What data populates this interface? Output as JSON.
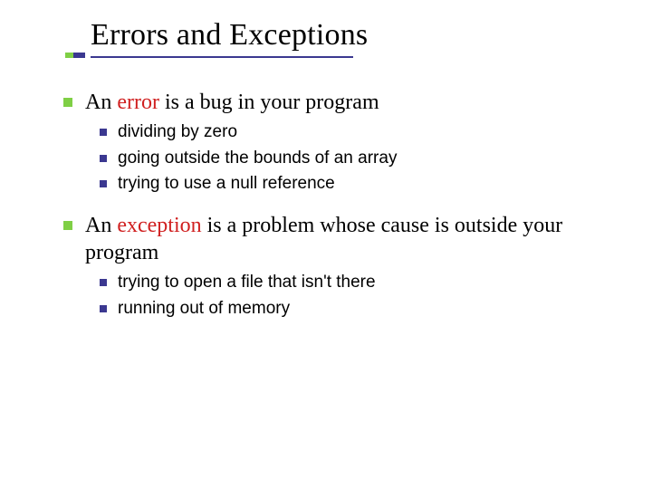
{
  "title": "Errors and Exceptions",
  "p1": {
    "pre": "An ",
    "em": "error",
    "post": " is a bug in your program",
    "items": {
      "0": "dividing by zero",
      "1": "going outside the bounds of an array",
      "2_pre": "trying to use a ",
      "2_code": "null",
      "2_post": " reference"
    }
  },
  "p2": {
    "pre": "An ",
    "em": "exception",
    "post": " is a problem whose cause is outside your program",
    "items": {
      "0": "trying to open a file that isn't there",
      "1": "running out of memory"
    }
  }
}
